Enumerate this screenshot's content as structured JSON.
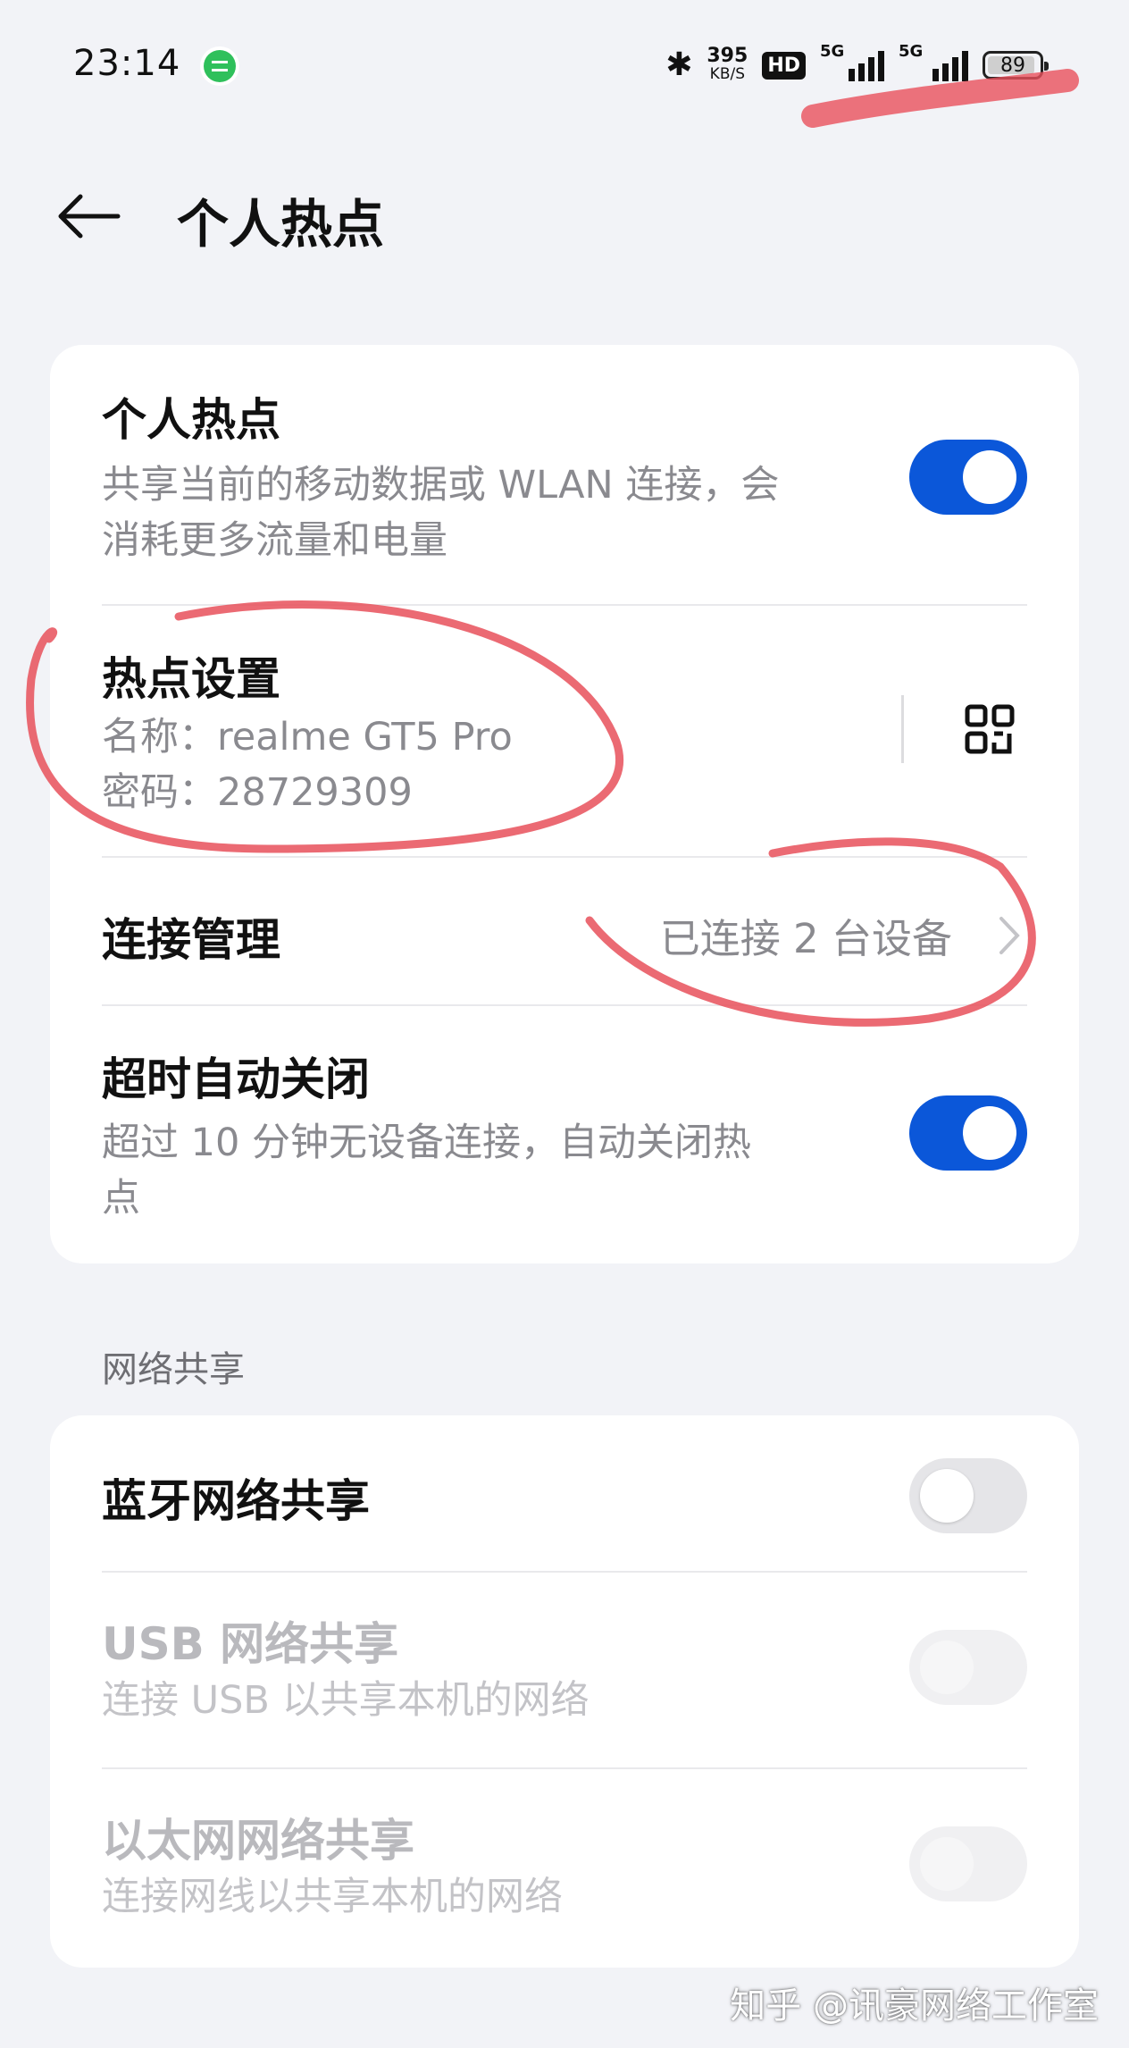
{
  "status_bar": {
    "time": "23:14",
    "notification_icon": "chat-bubble-icon",
    "bluetooth_icon": "bluetooth-icon",
    "speed_value": "395",
    "speed_unit": "KB/S",
    "hd_badge": "HD",
    "sim1_label": "5G",
    "sim2_label": "5G",
    "battery_level": "89"
  },
  "header": {
    "back_icon": "back-arrow-icon",
    "title": "个人热点"
  },
  "hotspot_card": {
    "hotspot": {
      "title": "个人热点",
      "description_line1": "共享当前的移动数据或 WLAN 连接，会",
      "description_line2": "消耗更多流量和电量",
      "enabled": true
    },
    "settings": {
      "title": "热点设置",
      "name_line": "名称：realme GT5 Pro",
      "password_line": "密码：28729309",
      "qr_icon": "qr-code-icon"
    },
    "connection": {
      "title": "连接管理",
      "value": "已连接 2 台设备",
      "chevron_icon": "chevron-right-icon"
    },
    "auto_off": {
      "title": "超时自动关闭",
      "description_line1": "超过 10 分钟无设备连接，自动关闭热",
      "description_line2": "点",
      "enabled": true
    }
  },
  "network_sharing": {
    "section_label": "网络共享",
    "bluetooth": {
      "title": "蓝牙网络共享",
      "enabled": false
    },
    "usb": {
      "title": "USB 网络共享",
      "description": "连接 USB 以共享本机的网络",
      "enabled": false
    },
    "ethernet": {
      "title": "以太网网络共享",
      "description": "连接网线以共享本机的网络",
      "enabled": false
    }
  },
  "watermark": "知乎 @讯豪网络工作室",
  "colors": {
    "accent": "#0b57d9",
    "background": "#f2f3f7",
    "annotation": "#e8505b"
  }
}
